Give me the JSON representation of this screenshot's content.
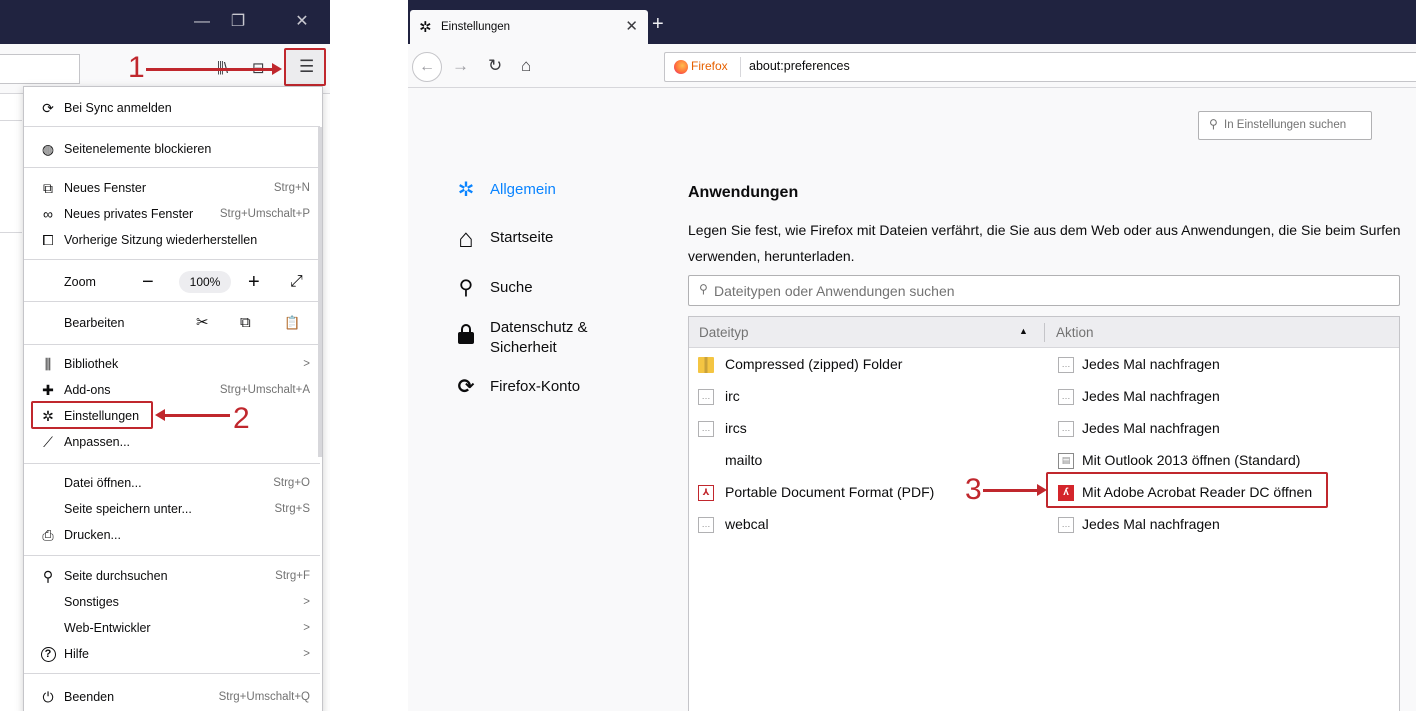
{
  "left_window": {
    "controls": {
      "minimize": "—",
      "restore": "❐",
      "close": "✕"
    },
    "annotation_1": "1",
    "menu": {
      "items": [
        {
          "icon": "sync-icon",
          "glyph": "⟳",
          "label": "Bei Sync anmelden",
          "shortcut": ""
        },
        {
          "icon": "shield-icon",
          "glyph": "◍",
          "label": "Seitenelemente blockieren",
          "shortcut": ""
        },
        {
          "icon": "new-window-icon",
          "glyph": "⧉",
          "label": "Neues Fenster",
          "shortcut": "Strg+N"
        },
        {
          "icon": "private-mask-icon",
          "glyph": "∞",
          "label": "Neues privates Fenster",
          "shortcut": "Strg+Umschalt+P"
        },
        {
          "icon": "restore-session-icon",
          "glyph": "⧠",
          "label": "Vorherige Sitzung wiederherstellen",
          "shortcut": ""
        },
        {
          "icon": "",
          "glyph": "",
          "label": "Zoom",
          "shortcut": ""
        },
        {
          "icon": "",
          "glyph": "",
          "label": "Bearbeiten",
          "shortcut": ""
        },
        {
          "icon": "library-icon",
          "glyph": "⫼",
          "label": "Bibliothek",
          "shortcut": ">"
        },
        {
          "icon": "puzzle-icon",
          "glyph": "✚",
          "label": "Add-ons",
          "shortcut": "Strg+Umschalt+A"
        },
        {
          "icon": "gear-icon",
          "glyph": "✲",
          "label": "Einstellungen",
          "shortcut": ""
        },
        {
          "icon": "brush-icon",
          "glyph": "⟋",
          "label": "Anpassen...",
          "shortcut": ""
        },
        {
          "icon": "",
          "glyph": "",
          "label": "Datei öffnen...",
          "shortcut": "Strg+O"
        },
        {
          "icon": "",
          "glyph": "",
          "label": "Seite speichern unter...",
          "shortcut": "Strg+S"
        },
        {
          "icon": "printer-icon",
          "glyph": "⎙",
          "label": "Drucken...",
          "shortcut": ""
        },
        {
          "icon": "search-icon",
          "glyph": "⚲",
          "label": "Seite durchsuchen",
          "shortcut": "Strg+F"
        },
        {
          "icon": "",
          "glyph": "",
          "label": "Sonstiges",
          "shortcut": ">"
        },
        {
          "icon": "",
          "glyph": "",
          "label": "Web-Entwickler",
          "shortcut": ">"
        },
        {
          "icon": "help-icon",
          "glyph": "?",
          "label": "Hilfe",
          "shortcut": ">"
        },
        {
          "icon": "power-icon",
          "glyph": "⏻",
          "label": "Beenden",
          "shortcut": "Strg+Umschalt+Q"
        }
      ],
      "zoom": {
        "minus": "−",
        "value": "100%",
        "plus": "+",
        "fullscreen": "⤢"
      },
      "edit": {
        "cut": "✂",
        "copy": "⧉",
        "paste": "📋"
      }
    },
    "annotation_2": "2"
  },
  "right_window": {
    "tab": {
      "title": "Einstellungen",
      "close": "✕",
      "new_tab": "+"
    },
    "nav": {
      "back": "←",
      "forward": "→",
      "reload": "↻",
      "home": "⌂"
    },
    "url": {
      "brand": "Firefox",
      "address": "about:preferences"
    },
    "search_placeholder": "In Einstellungen suchen",
    "categories": [
      {
        "icon": "gear-icon",
        "glyph": "✲",
        "label": "Allgemein",
        "selected": true
      },
      {
        "icon": "home-icon",
        "glyph": "⌂",
        "label": "Startseite",
        "selected": false
      },
      {
        "icon": "search-icon",
        "glyph": "⚲",
        "label": "Suche",
        "selected": false
      },
      {
        "icon": "lock-icon",
        "glyph": "🔒",
        "label": "Datenschutz &",
        "label2": "Sicherheit",
        "selected": false
      },
      {
        "icon": "sync-icon",
        "glyph": "⟳",
        "label": "Firefox-Konto",
        "selected": false
      }
    ],
    "applications": {
      "heading": "Anwendungen",
      "description": "Legen Sie fest, wie Firefox mit Dateien verfährt, die Sie aus dem Web oder aus Anwendungen, die Sie beim Surfen verwenden, herunterladen.",
      "filter_placeholder": "Dateitypen oder Anwendungen suchen",
      "columns": {
        "type": "Dateityp",
        "sort": "▲",
        "action": "Aktion"
      },
      "rows": [
        {
          "type": "Compressed (zipped) Folder",
          "type_icon": "zip-folder-icon",
          "action": "Jedes Mal nachfragen",
          "action_icon": "ask-icon"
        },
        {
          "type": "irc",
          "type_icon": "chat-icon",
          "action": "Jedes Mal nachfragen",
          "action_icon": "ask-icon"
        },
        {
          "type": "ircs",
          "type_icon": "chat-icon",
          "action": "Jedes Mal nachfragen",
          "action_icon": "ask-icon"
        },
        {
          "type": "mailto",
          "type_icon": "",
          "action": "Mit Outlook 2013 öffnen (Standard)",
          "action_icon": "outlook-icon"
        },
        {
          "type": "Portable Document Format (PDF)",
          "type_icon": "pdf-icon",
          "action": "Mit Adobe Acrobat Reader DC  öffnen",
          "action_icon": "acrobat-icon"
        },
        {
          "type": "webcal",
          "type_icon": "chat-icon",
          "action": "Jedes Mal nachfragen",
          "action_icon": "ask-icon"
        }
      ]
    },
    "annotation_3": "3"
  }
}
